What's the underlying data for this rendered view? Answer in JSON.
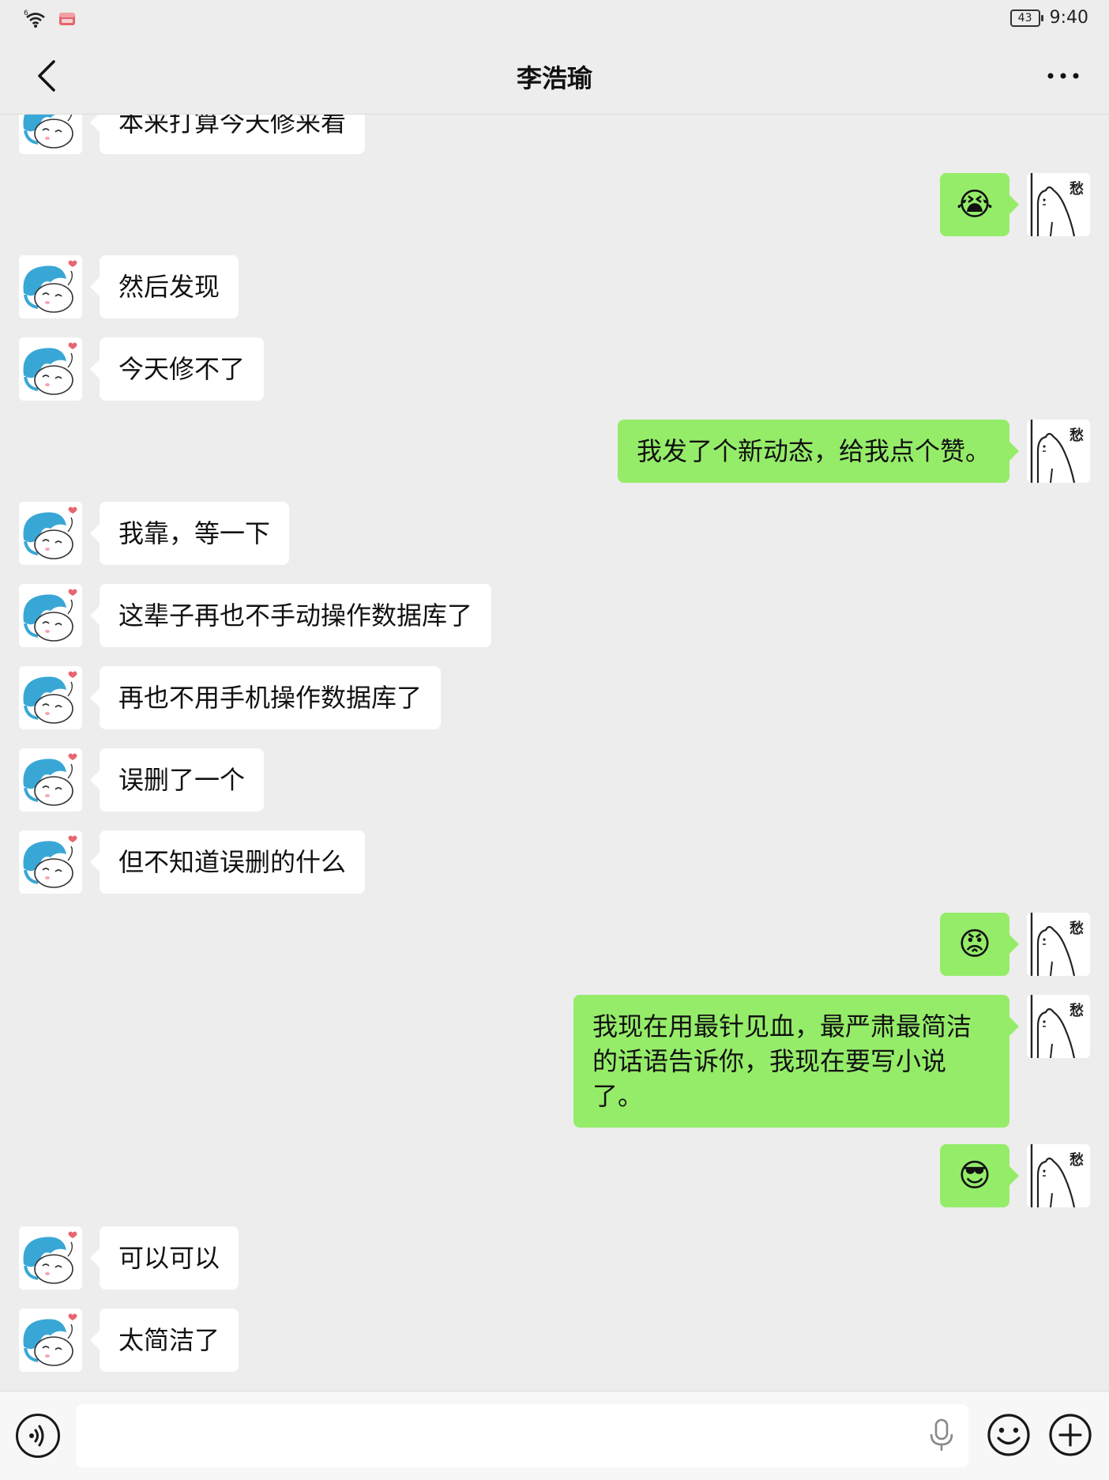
{
  "status_bar": {
    "signal_label": "6",
    "battery_level": "43",
    "time": "9:40"
  },
  "header": {
    "title": "李浩瑜"
  },
  "messages": [
    {
      "side": "left",
      "text": "本来打算今天修来看"
    },
    {
      "side": "right",
      "emoji": "😭"
    },
    {
      "side": "left",
      "text": "然后发现"
    },
    {
      "side": "left",
      "text": "今天修不了"
    },
    {
      "side": "right",
      "text": "我发了个新动态，给我点个赞。"
    },
    {
      "side": "left",
      "text": "我靠，等一下"
    },
    {
      "side": "left",
      "text": "这辈子再也不手动操作数据库了"
    },
    {
      "side": "left",
      "text": "再也不用手机操作数据库了"
    },
    {
      "side": "left",
      "text": "误删了一个"
    },
    {
      "side": "left",
      "text": "但不知道误删的什么"
    },
    {
      "side": "right",
      "emoji": "😡"
    },
    {
      "side": "right",
      "text": "我现在用最针见血，最严肃最简洁的话语告诉你，我现在要写小说了。"
    },
    {
      "side": "right",
      "emoji": "😎"
    },
    {
      "side": "left",
      "text": "可以可以"
    },
    {
      "side": "left",
      "text": "太简洁了"
    }
  ],
  "avatars": {
    "contact": "contact-avatar",
    "self": "self-avatar",
    "self_caption": "愁"
  },
  "input_bar": {
    "text_value": "",
    "icons": [
      "voice-icon",
      "mic-icon",
      "emoji-icon",
      "plus-icon"
    ]
  },
  "colors": {
    "background": "#ededed",
    "self_bubble": "#95ec69",
    "contact_bubble": "#ffffff"
  }
}
